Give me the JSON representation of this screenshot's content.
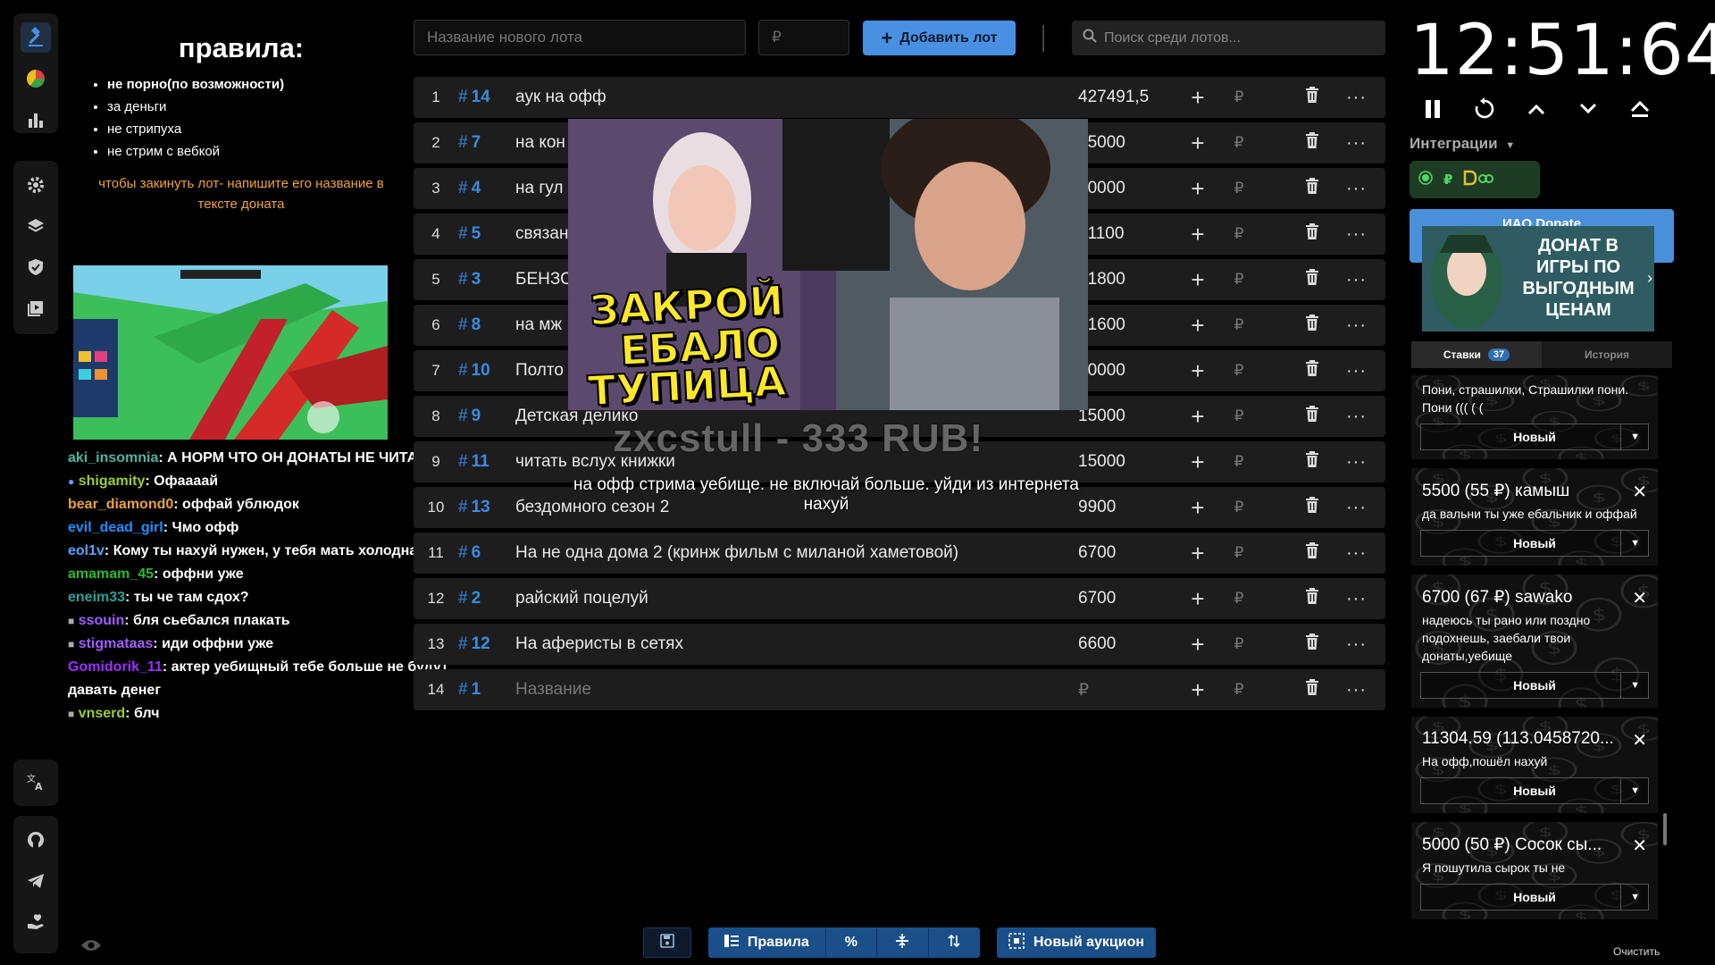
{
  "rules": {
    "title": "правила:",
    "items": [
      "не порно(по возможности)",
      "за деньги",
      "не стрипуха",
      "не стрим с вебкой"
    ],
    "note": "чтобы закинуть лот- напишите его название в тексте доната"
  },
  "chat": [
    {
      "user": "aki_insomnia",
      "color": "#4fb3a0",
      "text": "А НОРМ ЧТО ОН ДОНАТЫ НЕ ЧИТАЕТ?"
    },
    {
      "user": "shigamity",
      "color": "#9acd32",
      "text": "Офаааай"
    },
    {
      "user": "bear_diamond0",
      "color": "#e8a33d",
      "text": "оффай ублюдок"
    },
    {
      "user": "evil_dead_girl",
      "color": "#1e90ff",
      "text": "Чмо офф"
    },
    {
      "user": "eol1v",
      "color": "#5aa0ff",
      "text": "Кому ты нахуй нужен, у тебя мать холодная"
    },
    {
      "user": "amamam_45",
      "color": "#2eb82e",
      "text": "оффни уже"
    },
    {
      "user": "eneim33",
      "color": "#2aa198",
      "text": "ты че там сдох?"
    },
    {
      "user": "ssouin",
      "color": "#a05cff",
      "text": "бля сьебался плакать"
    },
    {
      "user": "stigmataas",
      "color": "#a05cff",
      "text": "иди оффни уже"
    },
    {
      "user": "Gomidorik_11",
      "color": "#9b30ff",
      "text": "актер уебищный тебе больше не будут давать денег"
    },
    {
      "user": "vnserd",
      "color": "#9acd32",
      "text": "блч"
    }
  ],
  "topbar": {
    "lot_name_placeholder": "Название нового лота",
    "price_placeholder": "₽",
    "add_button": "Добавить лот",
    "search_placeholder": "Поиск среди лотов..."
  },
  "lots": [
    {
      "num": "1",
      "id": "14",
      "name": "аук на офф",
      "amount": "427491,5"
    },
    {
      "num": "2",
      "id": "7",
      "name": "на кон",
      "amount": "35000"
    },
    {
      "num": "3",
      "id": "4",
      "name": "на гул",
      "amount": "70000"
    },
    {
      "num": "4",
      "id": "5",
      "name": "связан",
      "amount": "61100"
    },
    {
      "num": "5",
      "id": "3",
      "name": "БЕНЗО",
      "amount": "21800"
    },
    {
      "num": "6",
      "id": "8",
      "name": "на мж",
      "amount": "21600"
    },
    {
      "num": "7",
      "id": "10",
      "name": "Полто",
      "amount": "20000"
    },
    {
      "num": "8",
      "id": "9",
      "name": "Детская делико",
      "amount": "15000"
    },
    {
      "num": "9",
      "id": "11",
      "name": "читать вслух книжки",
      "amount": "15000"
    },
    {
      "num": "10",
      "id": "13",
      "name": "бездомного сезон 2",
      "amount": "9900"
    },
    {
      "num": "11",
      "id": "6",
      "name": "На не одна дома 2 (кринж фильм с миланой хаметовой)",
      "amount": "6700"
    },
    {
      "num": "12",
      "id": "2",
      "name": "райский поцелуй",
      "amount": "6700"
    },
    {
      "num": "13",
      "id": "12",
      "name": "На аферисты в сетях",
      "amount": "6600"
    },
    {
      "num": "14",
      "id": "1",
      "name": "Название",
      "amount": "₽",
      "placeholder": true
    }
  ],
  "lot_currency": "₽",
  "video": {
    "banner": [
      "ЗАКРОЙ",
      "ЕБАЛО",
      "ТУПИЦА"
    ],
    "donor": "zxcstull - 333 RUB!",
    "message": "на офф стрима уебище. не включай больше. уйди из интернета нахуй"
  },
  "toolbar": {
    "rules_button": "Правила",
    "percent": "%",
    "new_auction": "Новый аукцион"
  },
  "timer": {
    "value": "12:51:64"
  },
  "integrations": {
    "label": "Интеграции",
    "currency": "₽"
  },
  "ad": {
    "header": "ИАО Donate",
    "title": "ДОНАТ В ИГРЫ ПО ВЫГОДНЫМ ЦЕНАМ"
  },
  "tabs": {
    "bids": "Ставки",
    "bids_count": "37",
    "history": "История"
  },
  "donations": [
    {
      "title": "",
      "message": "Пони, страшилки, Страшилки пони. Пони ((( ( (",
      "status": "Новый"
    },
    {
      "title": "5500 (55 ₽) камыш",
      "message": "да вальни ты уже ебальник и оффай",
      "status": "Новый"
    },
    {
      "title": "6700 (67 ₽) sawako",
      "message": "надеюсь ты рано или поздно подохнешь, заебали твои донаты,уебище",
      "status": "Новый"
    },
    {
      "title": "11304.59 (113.0458720...",
      "message": "На офф,пошёл нахуй",
      "status": "Новый"
    },
    {
      "title": "5000 (50 ₽) Сосок сы...",
      "message": "Я пошутила сырок ты не",
      "status": "Новый"
    }
  ],
  "clear_button": "Очистить",
  "colors": {
    "accent": "#4a90e2",
    "lot_id": "#3a8be0",
    "note": "#f0a33a",
    "banner": "#ffe829"
  }
}
